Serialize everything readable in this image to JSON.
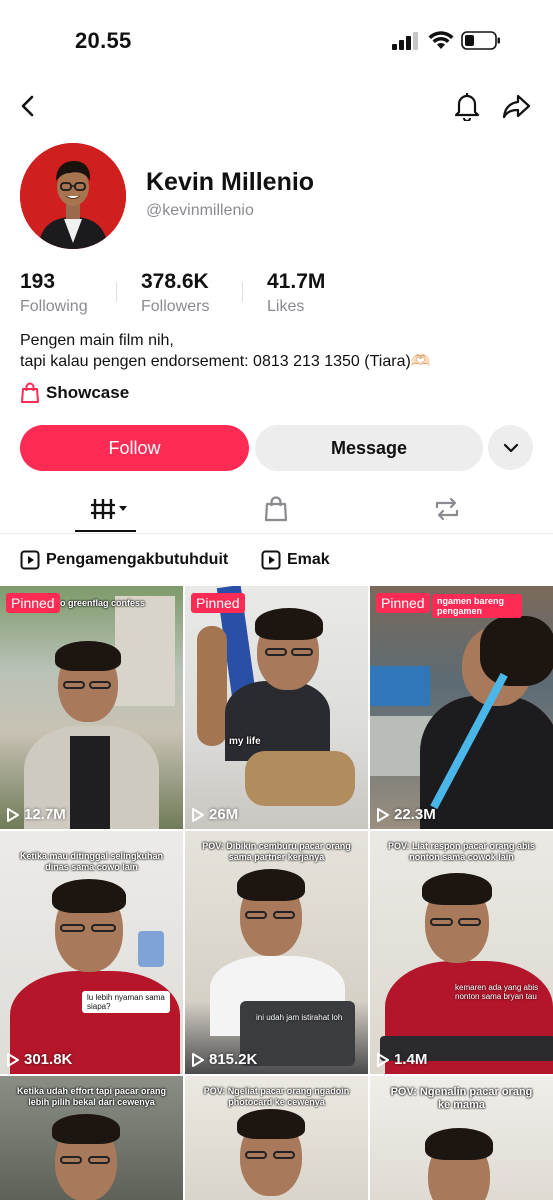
{
  "status": {
    "time": "20.55"
  },
  "profile": {
    "display_name": "Kevin Millenio",
    "username": "@kevinmillenio",
    "stats": [
      {
        "value": "193",
        "label": "Following"
      },
      {
        "value": "378.6K",
        "label": "Followers"
      },
      {
        "value": "41.7M",
        "label": "Likes"
      }
    ],
    "bio_lines": [
      "Pengen main film nih,",
      "tapi kalau pengen endorsement: 0813 213 1350 (Tiara)🫶🏻"
    ],
    "showcase_label": "Showcase"
  },
  "actions": {
    "follow": "Follow",
    "message": "Message"
  },
  "tabs": [
    {
      "icon": "grid-icon",
      "active": true
    },
    {
      "icon": "bag-icon",
      "active": false
    },
    {
      "icon": "repost-icon",
      "active": false
    }
  ],
  "playlists": [
    {
      "label": "Pengamengakbutuhduit",
      "icon": "play-square-icon"
    },
    {
      "label": "Emak",
      "icon": "play-square-icon"
    }
  ],
  "videos": [
    {
      "pinned": "Pinned",
      "views": "12.7M",
      "caption": "o greenflag confess"
    },
    {
      "pinned": "Pinned",
      "views": "26M",
      "caption": "my life"
    },
    {
      "pinned": "Pinned",
      "views": "22.3M",
      "caption": "ngamen bareng pengamen"
    },
    {
      "pinned": "",
      "views": "301.8K",
      "caption": "Ketika mau ditinggal selingkuhan dinas sama cowo lain",
      "caption2": "lu lebih nyaman sama siapa?"
    },
    {
      "pinned": "",
      "views": "815.2K",
      "caption": "POV: Dibikin cemburu pacar orang sama partner kerjanya",
      "caption2": "ini udah jam istirahat loh"
    },
    {
      "pinned": "",
      "views": "1.4M",
      "caption": "POV: Liat respon pacar orang abis nonton sama cowok lain",
      "caption2": "kemaren ada yang abis nonton sama bryan tau"
    },
    {
      "pinned": "",
      "views": "",
      "caption": "Ketika udah effort tapi pacar orang lebih pilih bekal dari cewenya"
    },
    {
      "pinned": "",
      "views": "",
      "caption": "POV: Ngeliat pacar orang ngadoin photocard ke cewenya"
    },
    {
      "pinned": "",
      "views": "",
      "caption": "POV: Ngenalin pacar orang ke mama"
    }
  ],
  "colors": {
    "accent": "#fe2c55",
    "muted_text": "#8a8b91",
    "button_gray": "#ededee"
  }
}
